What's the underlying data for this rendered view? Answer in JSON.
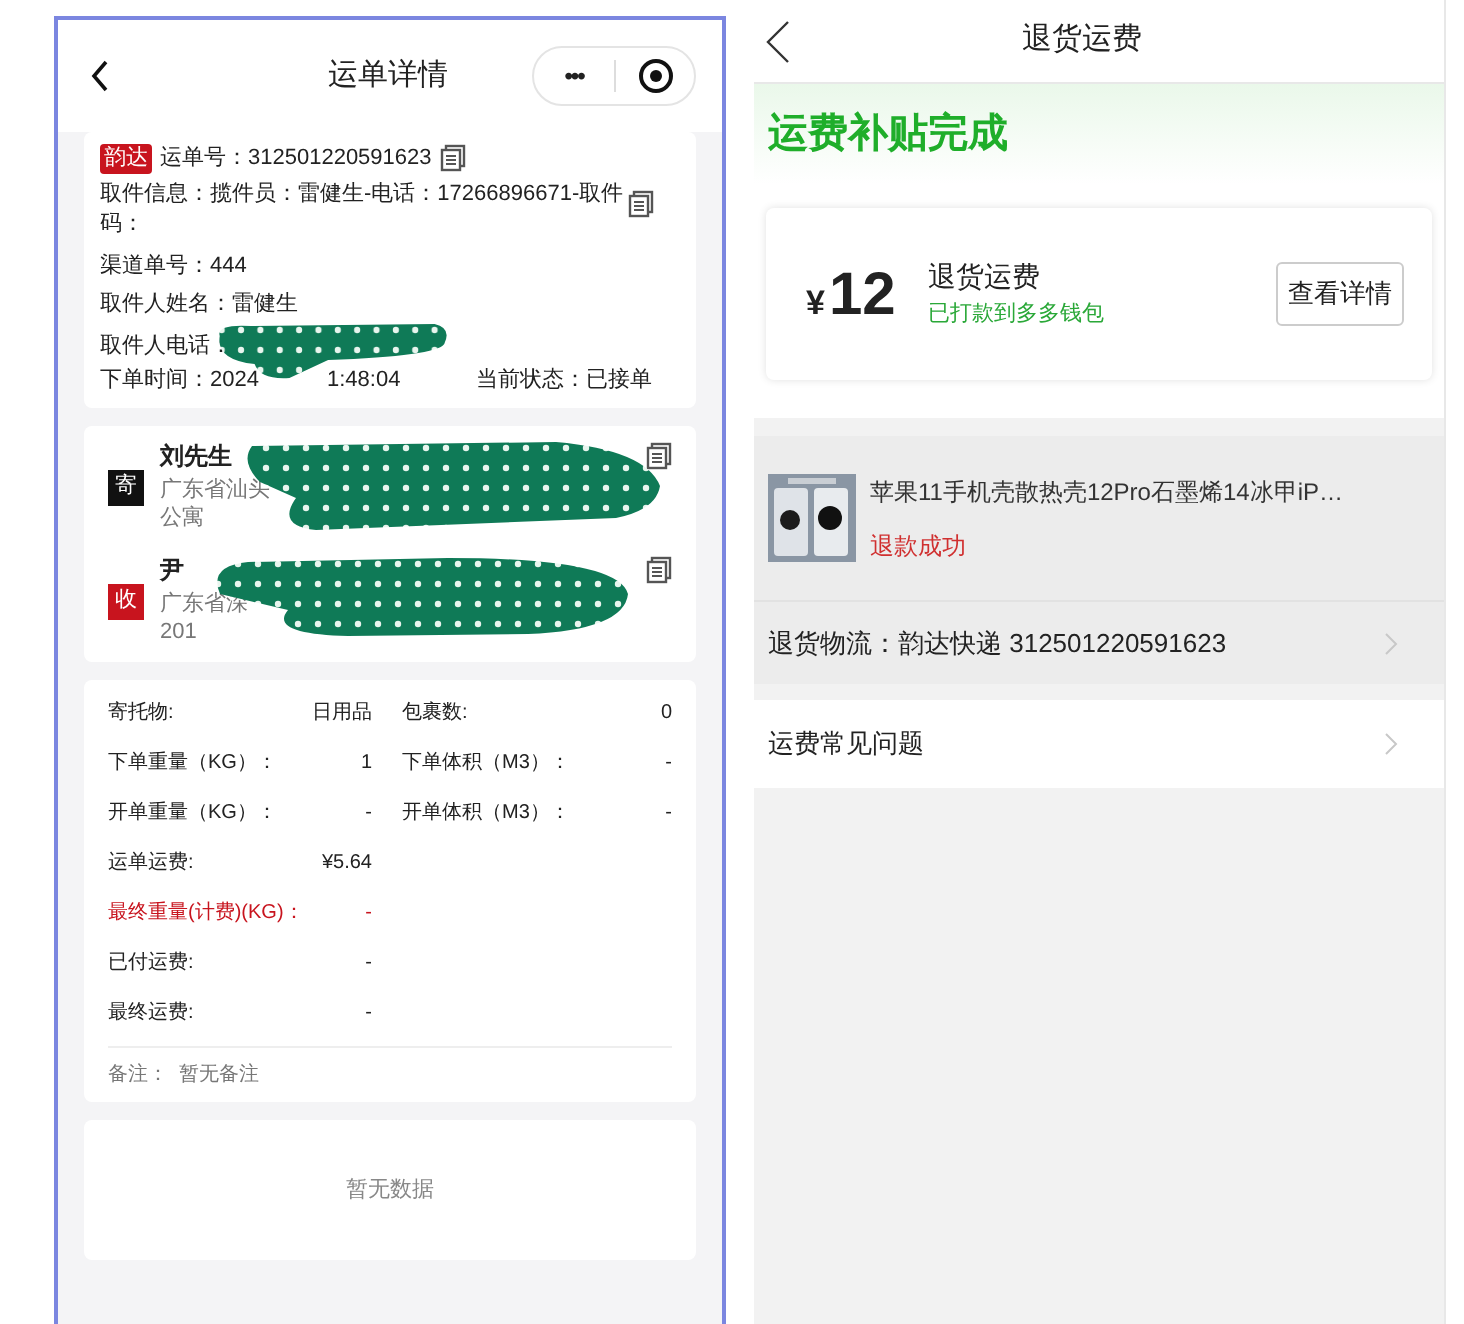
{
  "left": {
    "title": "运单详情",
    "menu_button": "•••",
    "waybill": {
      "carrier_tag": "韵达",
      "number_label": "运单号：",
      "number": "312501220591623"
    },
    "pickup_info": "取件信息：揽件员：雷健生-电话：17266896671-取件码：",
    "channel_no": "渠道单号：444",
    "pickup_name": "取件人姓名：雷健生",
    "pickup_phone_label": "取件人电话：",
    "order_time_start": "下单时间：2024",
    "order_time_end": "1:48:04",
    "status": "当前状态：已接单",
    "parties": [
      {
        "tag": "寄",
        "color": "#111111",
        "name": "刘先生",
        "address_start": "广东省汕头",
        "address_end": "公寓"
      },
      {
        "tag": "收",
        "color": "#c8141e",
        "name": "尹",
        "address_start": "广东省深",
        "address_end": "201"
      }
    ],
    "details": [
      {
        "label": "寄托物:",
        "value": "日用品",
        "label2": "包裹数:",
        "value2": "0",
        "warning": false
      },
      {
        "label": "下单重量（KG）：",
        "value": "1",
        "label2": "下单体积（M3）：",
        "value2": "-",
        "warning": false
      },
      {
        "label": "开单重量（KG）：",
        "value": "-",
        "label2": "开单体积（M3）：",
        "value2": "-",
        "warning": false
      },
      {
        "label": "运单运费:",
        "value": "¥5.64",
        "warning": false
      },
      {
        "label": "最终重量(计费)(KG)：",
        "value": "-",
        "warning": true
      },
      {
        "label": "已付运费:",
        "value": "-",
        "warning": false
      },
      {
        "label": "最终运费:",
        "value": "-",
        "warning": false
      }
    ],
    "remark": "备注：  暂无备注",
    "empty": "暂无数据"
  },
  "right": {
    "title": "退货运费",
    "banner": "运费补贴完成",
    "amount_currency": "¥",
    "amount": "12",
    "fee_title": "退货运费",
    "fee_note": "已打款到多多钱包",
    "detail_button": "查看详情",
    "product": {
      "name": "苹果11手机壳散热壳12Pro石墨烯14冰甲iP…",
      "status": "退款成功"
    },
    "logistics": "退货物流：韵达快递 312501220591623",
    "faq": "运费常见问题"
  }
}
